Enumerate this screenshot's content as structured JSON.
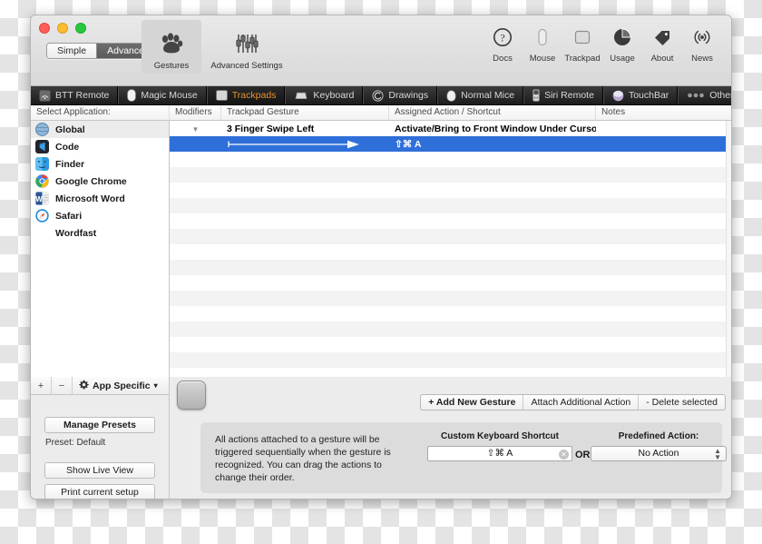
{
  "window": {
    "traffic_lights": [
      "close",
      "minimize",
      "maximize"
    ]
  },
  "mode_switch": {
    "options": [
      "Simple",
      "Advanced"
    ],
    "selected": "Advanced"
  },
  "toolbar_left": [
    {
      "label": "Gestures",
      "icon": "paw-icon",
      "active": true
    },
    {
      "label": "Advanced Settings",
      "icon": "sliders-icon",
      "active": false
    }
  ],
  "toolbar_right": [
    {
      "label": "Docs",
      "icon": "question-circle-icon"
    },
    {
      "label": "Mouse",
      "icon": "mouse-icon"
    },
    {
      "label": "Trackpad",
      "icon": "trackpad-icon"
    },
    {
      "label": "Usage",
      "icon": "pie-chart-icon"
    },
    {
      "label": "About",
      "icon": "tag-icon"
    },
    {
      "label": "News",
      "icon": "broadcast-icon"
    }
  ],
  "device_tabs": [
    {
      "label": "BTT Remote",
      "icon": "remote-icon",
      "selected": false
    },
    {
      "label": "Magic Mouse",
      "icon": "magic-mouse-icon",
      "selected": false
    },
    {
      "label": "Trackpads",
      "icon": "trackpad-icon",
      "selected": true
    },
    {
      "label": "Keyboard",
      "icon": "keyboard-icon",
      "selected": false
    },
    {
      "label": "Drawings",
      "icon": "drawing-icon",
      "selected": false
    },
    {
      "label": "Normal Mice",
      "icon": "normal-mouse-icon",
      "selected": false
    },
    {
      "label": "Siri Remote",
      "icon": "siri-remote-icon",
      "selected": false
    },
    {
      "label": "TouchBar",
      "icon": "touchbar-icon",
      "selected": false
    },
    {
      "label": "Other",
      "icon": "three-dots-icon",
      "selected": false
    }
  ],
  "tabstrip_overflow_icon": "triangle-down-icon",
  "table": {
    "sidebar_header": "Select Application:",
    "columns": [
      "Modifiers",
      "Trackpad Gesture",
      "Assigned Action / Shortcut",
      "Notes"
    ],
    "rows": [
      {
        "modifiers": "▼",
        "gesture": "3 Finger Swipe Left",
        "action": "Activate/Bring to Front Window Under Cursor",
        "notes": "",
        "selected": false,
        "type": "text"
      },
      {
        "modifiers": "",
        "gesture": "",
        "action": "⇧⌘ A",
        "notes": "",
        "selected": true,
        "type": "arrow"
      }
    ],
    "empty_row_count": 14
  },
  "sidebar": {
    "apps": [
      {
        "label": "Global",
        "icon": "globe-icon",
        "selected": true
      },
      {
        "label": "Code",
        "icon": "vscode-icon",
        "selected": false
      },
      {
        "label": "Finder",
        "icon": "finder-icon",
        "selected": false
      },
      {
        "label": "Google Chrome",
        "icon": "chrome-icon",
        "selected": false
      },
      {
        "label": "Microsoft Word",
        "icon": "word-icon",
        "selected": false
      },
      {
        "label": "Safari",
        "icon": "safari-icon",
        "selected": false
      },
      {
        "label": "Wordfast",
        "icon": "none",
        "selected": false
      }
    ]
  },
  "sidebar_footer": {
    "add_label": "+",
    "remove_label": "−",
    "app_specific_label": "App Specific",
    "app_specific_caret": "▾",
    "gear_icon": "gear-icon",
    "manage_presets": "Manage Presets",
    "preset_status": "Preset: Default",
    "show_live_view": "Show Live View",
    "print_current_setup": "Print current setup",
    "help_label": "?"
  },
  "action_bar": {
    "buttons": [
      {
        "label": "+ Add New Gesture",
        "bold": true
      },
      {
        "label": "Attach Additional Action",
        "bold": false
      },
      {
        "label": "- Delete selected",
        "bold": false
      }
    ]
  },
  "info_panel": {
    "text": "All actions attached to a gesture will be triggered sequentially when the gesture is recognized. You can drag the actions to change their order.",
    "shortcut_label": "Custom Keyboard Shortcut",
    "shortcut_value": "⇧⌘ A",
    "shortcut_clear_icon": "clear-circle-icon",
    "or_label": "OR",
    "predefined_label": "Predefined Action:",
    "predefined_value": "No Action"
  },
  "colors": {
    "selection_blue": "#2f6fd9",
    "tab_accent_orange": "#e8922f",
    "window_chrome": "#ececec",
    "tabstrip_dark": "#1c1c1c"
  }
}
